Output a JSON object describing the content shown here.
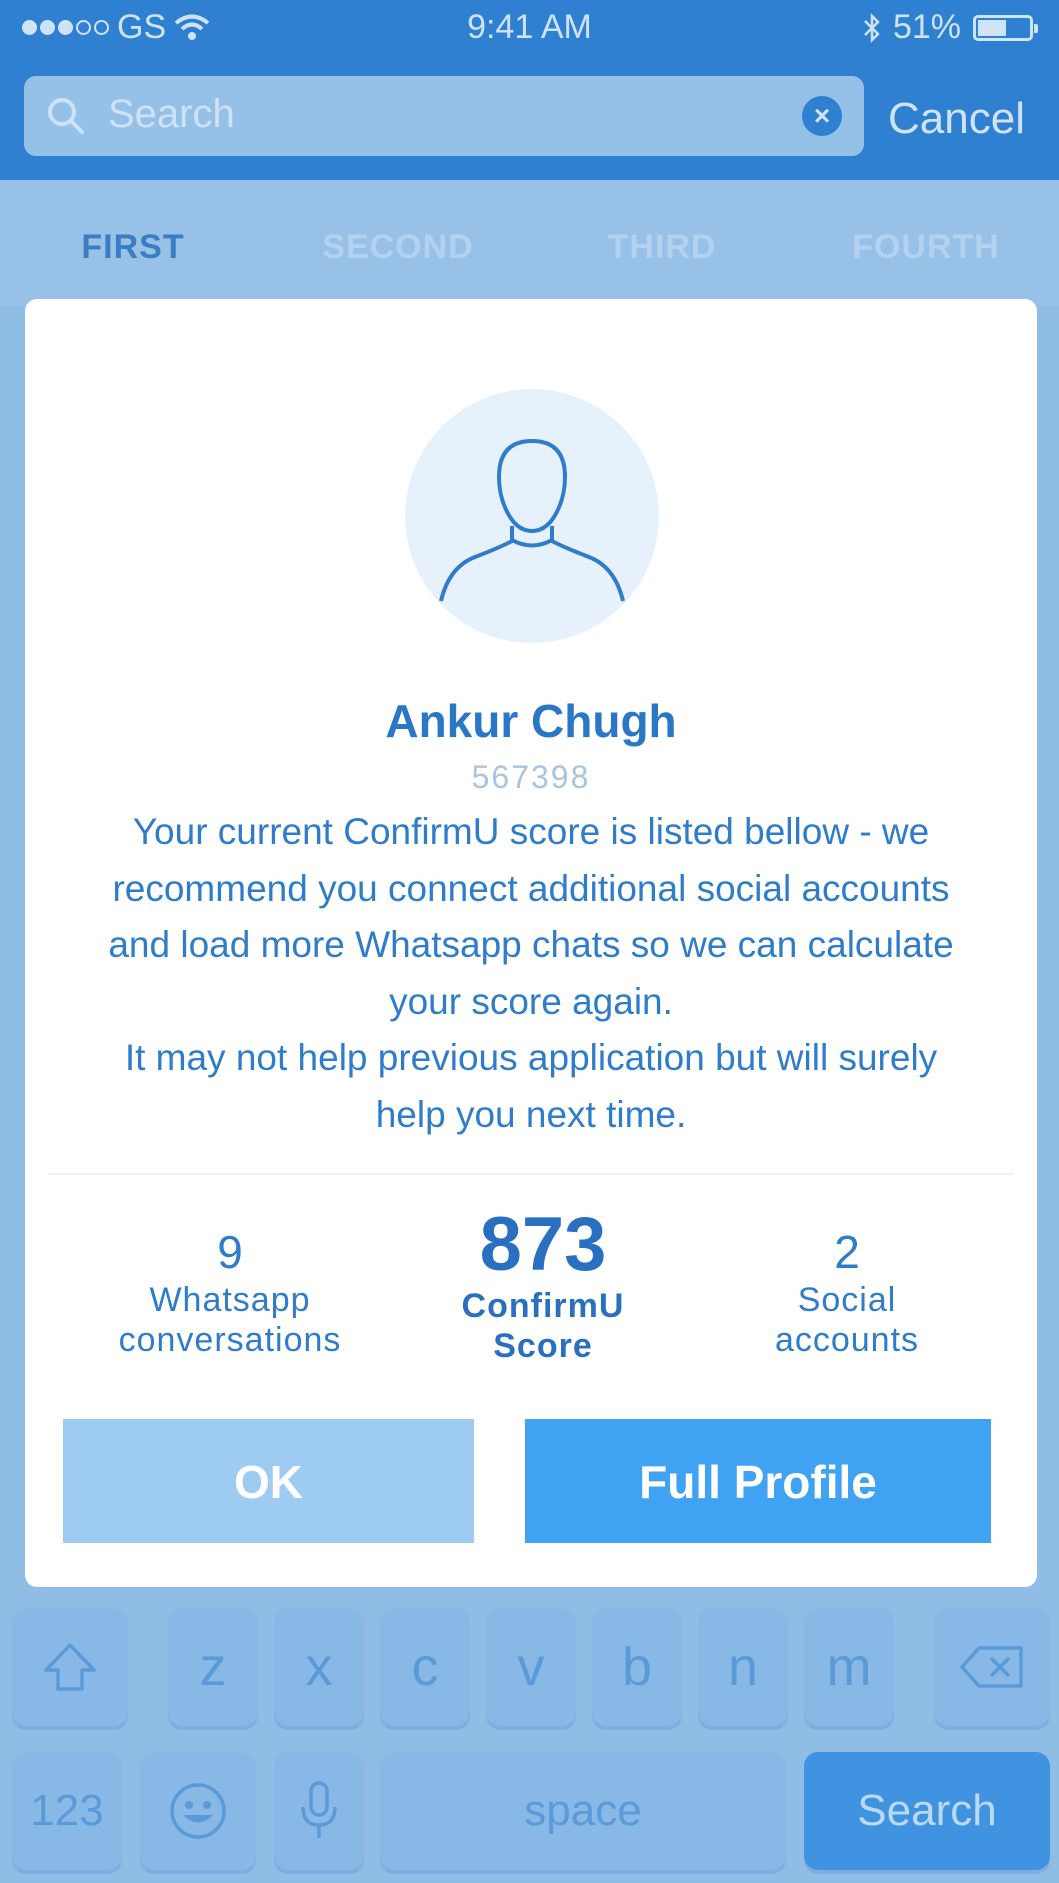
{
  "status_bar": {
    "carrier": "GS",
    "time": "9:41 AM",
    "battery": "51%",
    "battery_level": 0.51
  },
  "search": {
    "placeholder": "Search",
    "cancel_label": "Cancel"
  },
  "tabs": [
    {
      "label": "FIRST",
      "active": true
    },
    {
      "label": "SECOND",
      "active": false
    },
    {
      "label": "THIRD",
      "active": false
    },
    {
      "label": "FOURTH",
      "active": false
    }
  ],
  "modal": {
    "name": "Ankur Chugh",
    "user_id": "567398",
    "message_lines": [
      "Your current ConfirmU score is listed bellow - we",
      "recommend you connect additional social accounts",
      "and load more Whatsapp chats so we can calculate",
      "your score again.",
      "It may not help previous application but will surely",
      "help you next time."
    ],
    "stats": {
      "whatsapp": {
        "value": "9",
        "label_line1": "Whatsapp",
        "label_line2": "conversations"
      },
      "score": {
        "value": "873",
        "label_line1": "ConfirmU",
        "label_line2": "Score"
      },
      "social": {
        "value": "2",
        "label_line1": "Social",
        "label_line2": "accounts"
      }
    },
    "ok_label": "OK",
    "full_profile_label": "Full Profile"
  },
  "keyboard": {
    "letters": [
      "z",
      "x",
      "c",
      "v",
      "b",
      "n",
      "m"
    ],
    "numbers_label": "123",
    "space_label": "space",
    "search_label": "Search"
  },
  "colors": {
    "accent": "#2f80d0",
    "primary_button": "#3fa2f2",
    "secondary_button": "#9ecbf2"
  }
}
